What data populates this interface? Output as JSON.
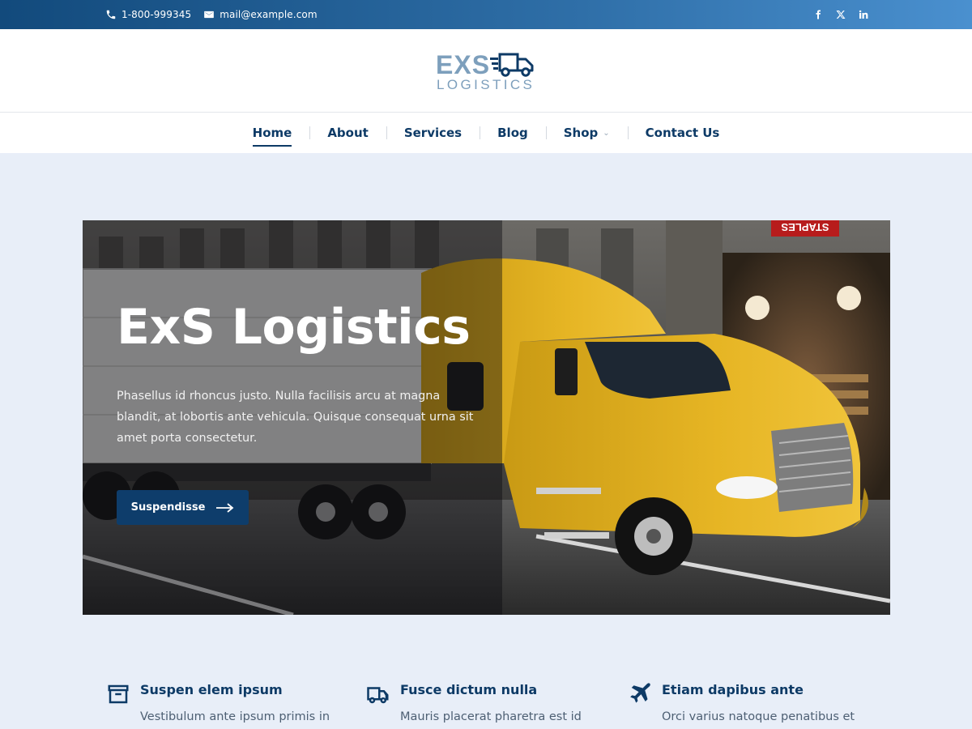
{
  "topbar": {
    "phone": "1-800-999345",
    "email": "mail@example.com",
    "social_icons": [
      "facebook-icon",
      "x-twitter-icon",
      "linkedin-icon"
    ]
  },
  "logo": {
    "top_text": "EXS",
    "bottom_text": "LOGISTICS",
    "icon": "truck-icon"
  },
  "nav": {
    "items": [
      {
        "label": "Home",
        "active": true
      },
      {
        "label": "About"
      },
      {
        "label": "Services"
      },
      {
        "label": "Blog"
      },
      {
        "label": "Shop",
        "has_dropdown": true
      },
      {
        "label": "Contact Us"
      }
    ],
    "dropdown_glyph": "⌄"
  },
  "hero": {
    "title": "ExS Logistics",
    "text": "Phasellus id rhoncus justo. Nulla facilisis arcu at magna blandit, at lobortis ante vehicula. Quisque consequat urna sit amet porta consectetur.",
    "button_label": "Suspendisse",
    "store_sign": "STAPLES"
  },
  "features": [
    {
      "icon": "archive-box-icon",
      "title": "Suspen elem ipsum",
      "text": "Vestibulum ante ipsum primis in"
    },
    {
      "icon": "truck-icon",
      "title": "Fusce dictum nulla",
      "text": "Mauris placerat pharetra est id"
    },
    {
      "icon": "airplane-icon",
      "title": "Etiam dapibus ante",
      "text": "Orci varius natoque penatibus et"
    }
  ],
  "colors": {
    "brand_navy": "#0d3a66",
    "topbar_gradient_start": "#124a7c",
    "topbar_gradient_end": "#4a90cf",
    "page_background": "#e8eef8",
    "truck_yellow": "#e3b21f"
  }
}
